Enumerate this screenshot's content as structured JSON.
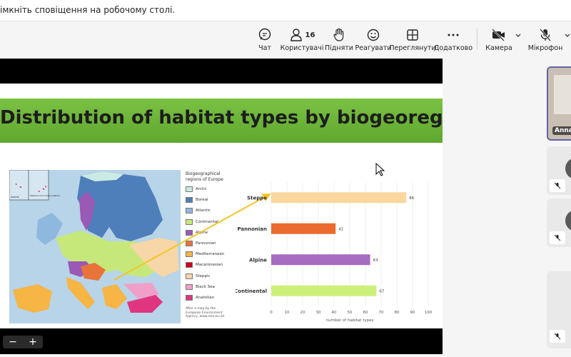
{
  "notification": {
    "text": "імкніть сповіщення на робочому столі."
  },
  "toolbar": {
    "chat": "Чат",
    "users": "Користувачі",
    "users_count": "16",
    "raise": "Підняти",
    "react": "Реагувати",
    "view": "Переглянути",
    "more": "Додатково",
    "camera": "Камера",
    "mic": "Мікрофон"
  },
  "slide": {
    "title": "Distribution of habitat types by biogeoregions",
    "map_insets": [
      "Azores",
      "Madeira and Canary Islands"
    ],
    "legend_title": "Biogeographical regions of Europe",
    "legend": [
      {
        "label": "Arctic",
        "color": "#c9ebe4"
      },
      {
        "label": "Boreal",
        "color": "#4f7fba"
      },
      {
        "label": "Atlantic",
        "color": "#8fb8de"
      },
      {
        "label": "Continental",
        "color": "#c6e87a"
      },
      {
        "label": "Alpine",
        "color": "#9b59b6"
      },
      {
        "label": "Pannonian",
        "color": "#e8743b"
      },
      {
        "label": "Mediterranean",
        "color": "#f6b544"
      },
      {
        "label": "Macaronesian",
        "color": "#d0021b"
      },
      {
        "label": "Steppic",
        "color": "#f7d6a8"
      },
      {
        "label": "Black Sea",
        "color": "#f0a0c8"
      },
      {
        "label": "Anatolian",
        "color": "#e0357f"
      }
    ],
    "legend_note": "After a map by the European Environment Agency, www.eea.eu.int"
  },
  "chart_data": {
    "type": "bar",
    "orientation": "horizontal",
    "categories": [
      "Steppe",
      "Pannonian",
      "Alpine",
      "Continental"
    ],
    "values": [
      86,
      41,
      63,
      67
    ],
    "colors": [
      "#f9d79f",
      "#eb6b2f",
      "#a66cc1",
      "#cdf07b"
    ],
    "xlabel": "number of habitat types",
    "xlim": [
      0,
      100
    ],
    "xticks": [
      0,
      10,
      20,
      30,
      40,
      50,
      60,
      70,
      80,
      90,
      100
    ],
    "grid": true
  },
  "participants": [
    {
      "name": "Anna"
    }
  ],
  "zoom": {
    "minus": "−",
    "plus": "+"
  }
}
